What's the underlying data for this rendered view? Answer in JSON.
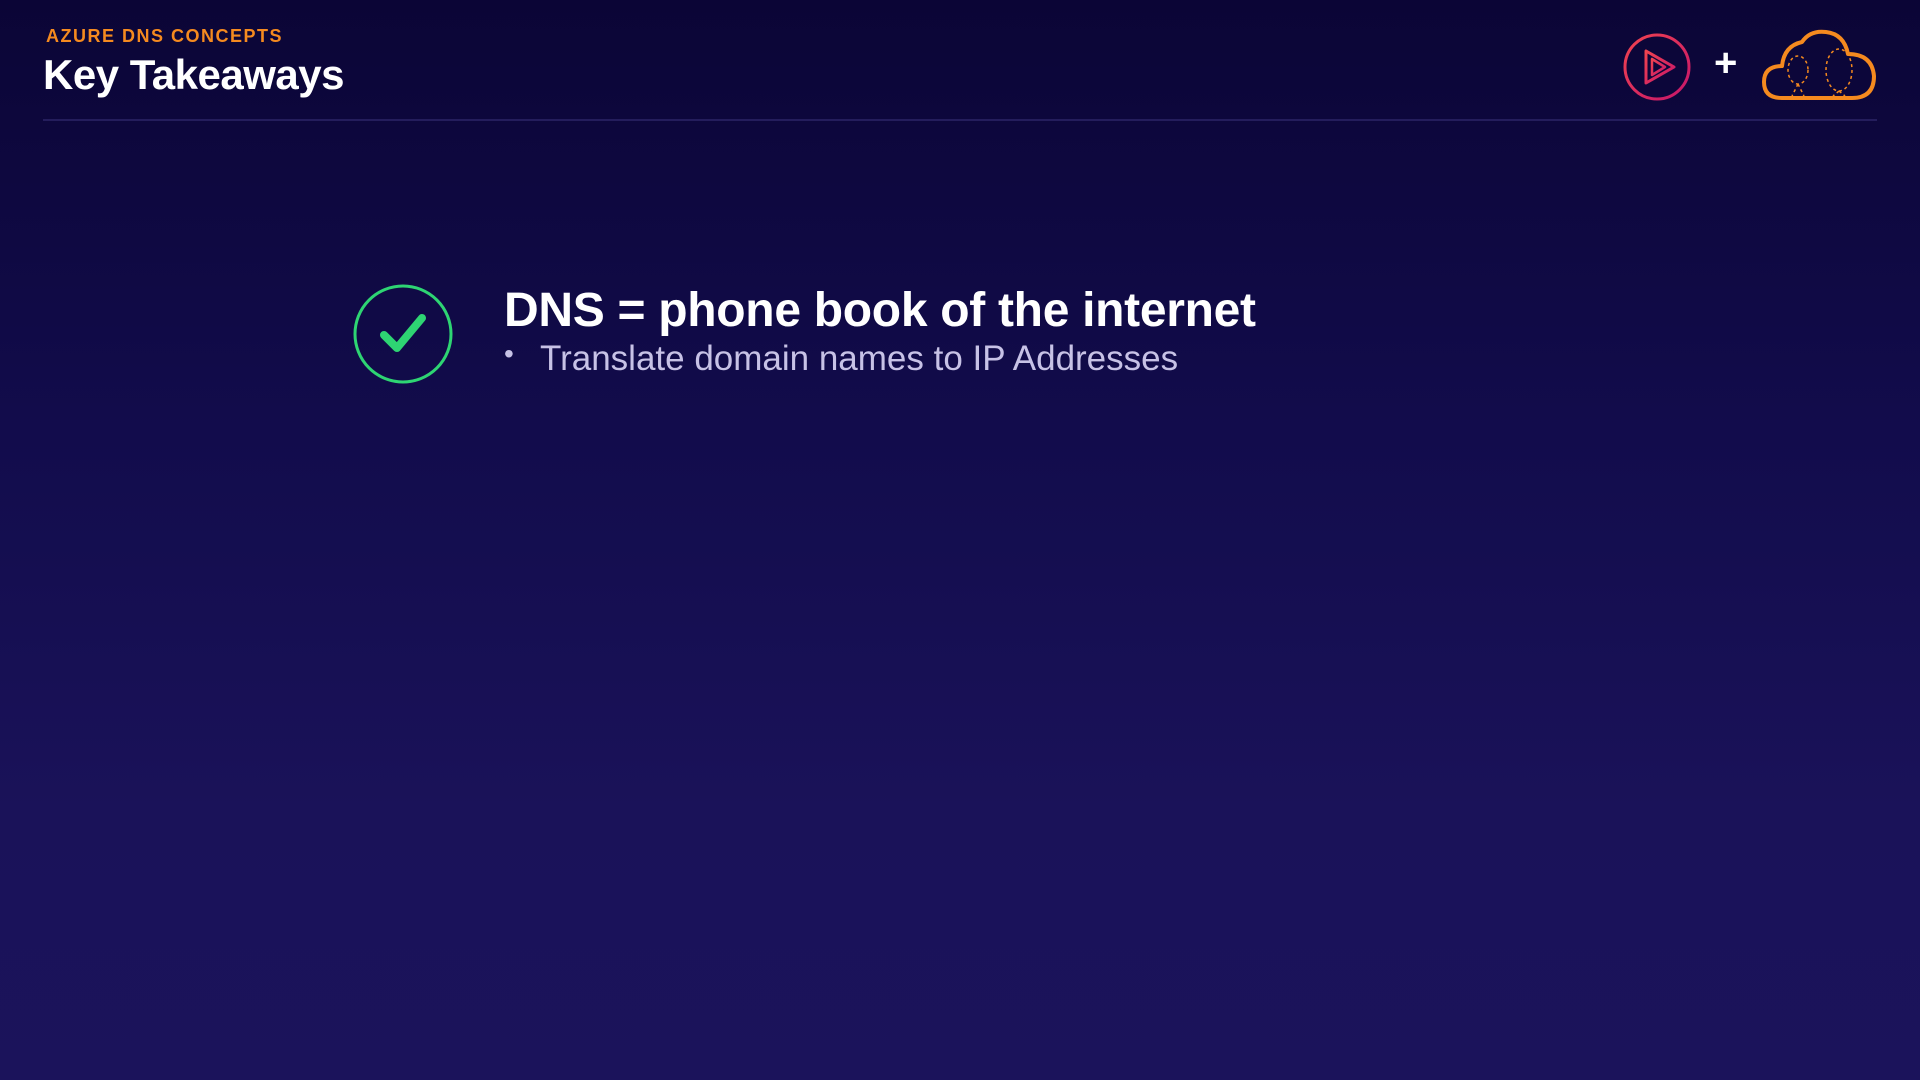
{
  "header": {
    "eyebrow": "AZURE DNS CONCEPTS",
    "title": "Key Takeaways",
    "plus": "+"
  },
  "logos": {
    "left_icon": "play-circle-icon",
    "right_icon": "cloud-icon"
  },
  "takeaways": [
    {
      "icon": "checkmark-circle-icon",
      "heading": "DNS = phone book of the internet",
      "bullets": [
        "Translate domain names to IP Addresses"
      ]
    }
  ],
  "colors": {
    "background_top": "#0b0536",
    "background_bottom": "#1b135b",
    "accent_orange": "#f58a1f",
    "accent_pink": "#e4235a",
    "check_green": "#2ed573",
    "text_primary": "#ffffff",
    "text_secondary": "#c7c2e6"
  }
}
